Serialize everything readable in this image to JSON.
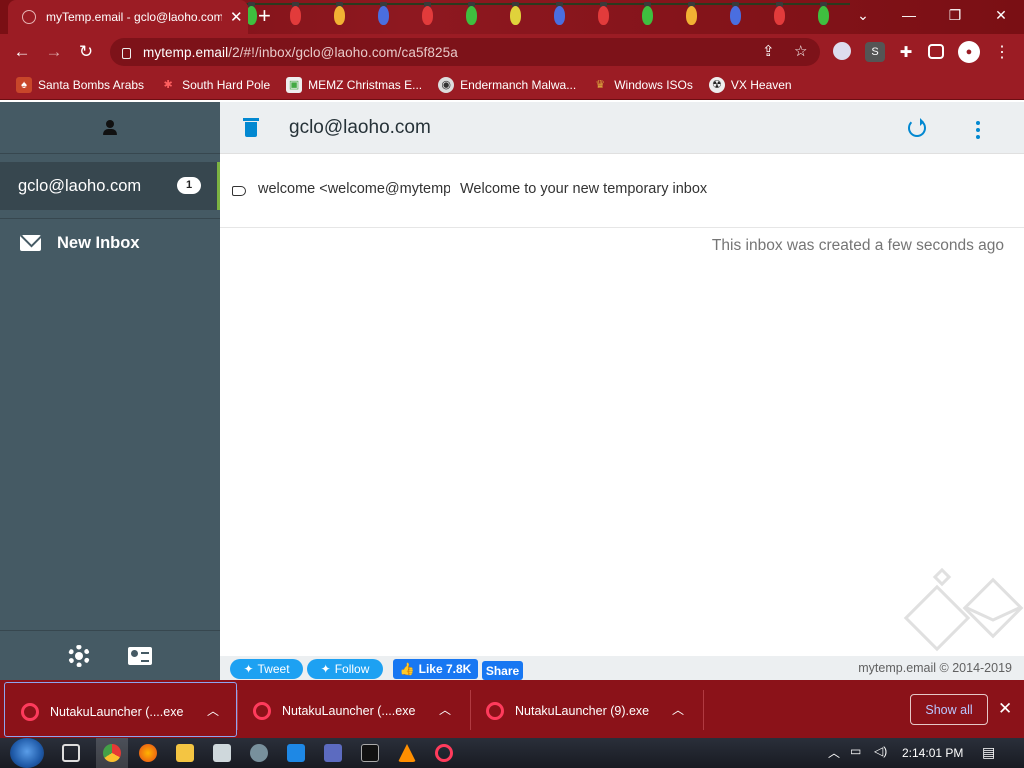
{
  "browser": {
    "tab_title": "myTemp.email - gclo@laoho.com",
    "url_host": "mytemp.email",
    "url_path": "/2/#!/inbox/gclo@laoho.com/ca5f825a",
    "bookmarks": [
      {
        "label": "Santa Bombs Arabs",
        "icon": "santa-icon"
      },
      {
        "label": "South Hard Pole",
        "icon": "snowflake-icon"
      },
      {
        "label": "MEMZ Christmas E...",
        "icon": "memz-icon"
      },
      {
        "label": "Endermanch Malwa...",
        "icon": "raccoon-icon"
      },
      {
        "label": "Windows ISOs",
        "icon": "crown-icon"
      },
      {
        "label": "VX Heaven",
        "icon": "vx-icon"
      }
    ],
    "extension_s_label": "S"
  },
  "sidebar": {
    "active_inbox": "gclo@laoho.com",
    "active_count": "1",
    "new_inbox_label": "New Inbox"
  },
  "main": {
    "title": "gclo@laoho.com",
    "messages": [
      {
        "from": "welcome <welcome@mytemp.email>",
        "subject": "Welcome to your new temporary inbox"
      }
    ],
    "created_note": "This inbox was created a few seconds ago"
  },
  "footer": {
    "tweet": "Tweet",
    "follow": "Follow",
    "like": "Like 7.8K",
    "share": "Share",
    "copyright": "mytemp.email © 2014-2019"
  },
  "downloads": {
    "items": [
      {
        "name": "NutakuLauncher (....exe"
      },
      {
        "name": "NutakuLauncher (....exe"
      },
      {
        "name": "NutakuLauncher (9).exe"
      }
    ],
    "show_all": "Show all"
  },
  "taskbar": {
    "time": "2:14:01 PM"
  },
  "colors": {
    "chrome_red": "#9b1c24",
    "sidebar": "#455a64",
    "accent_blue": "#0288d1",
    "active_bar": "#7cb342"
  }
}
